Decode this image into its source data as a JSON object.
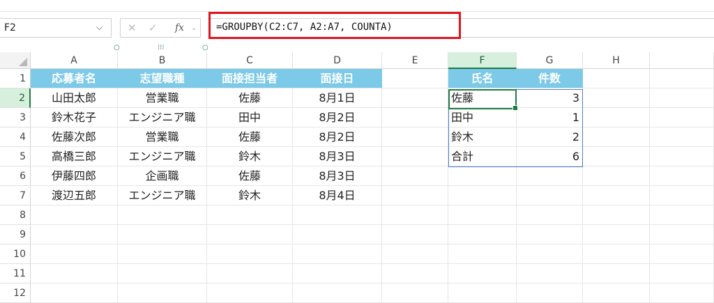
{
  "name_box": {
    "value": "F2",
    "chevron": "⌵"
  },
  "fx_buttons": {
    "cancel": "✕",
    "confirm": "✓",
    "fx": "fx"
  },
  "formula": "=GROUPBY(C2:C7, A2:A7, COUNTA)",
  "columns": [
    "A",
    "B",
    "C",
    "D",
    "E",
    "F",
    "G",
    "H"
  ],
  "rows": [
    "1",
    "2",
    "3",
    "4",
    "5",
    "6",
    "7",
    "8",
    "9",
    "10",
    "11",
    "12"
  ],
  "table_header": [
    "応募者名",
    "志望職種",
    "面接担当者",
    "面接日"
  ],
  "table_rows": [
    [
      "山田太郎",
      "営業職",
      "佐藤",
      "8月1日"
    ],
    [
      "鈴木花子",
      "エンジニア職",
      "田中",
      "8月2日"
    ],
    [
      "佐藤次郎",
      "営業職",
      "佐藤",
      "8月2日"
    ],
    [
      "高橋三郎",
      "エンジニア職",
      "鈴木",
      "8月3日"
    ],
    [
      "伊藤四郎",
      "企画職",
      "佐藤",
      "8月3日"
    ],
    [
      "渡辺五郎",
      "エンジニア職",
      "鈴木",
      "8月4日"
    ]
  ],
  "result_header": [
    "氏名",
    "件数"
  ],
  "result_rows": [
    [
      "佐藤",
      "3"
    ],
    [
      "田中",
      "1"
    ],
    [
      "鈴木",
      "2"
    ],
    [
      "合計",
      "6"
    ]
  ],
  "colors": {
    "header_fill": "#7cc9e8",
    "highlight_border": "#e0141e",
    "selection": "#1e7b43",
    "spill_border": "#4a7ec9"
  }
}
